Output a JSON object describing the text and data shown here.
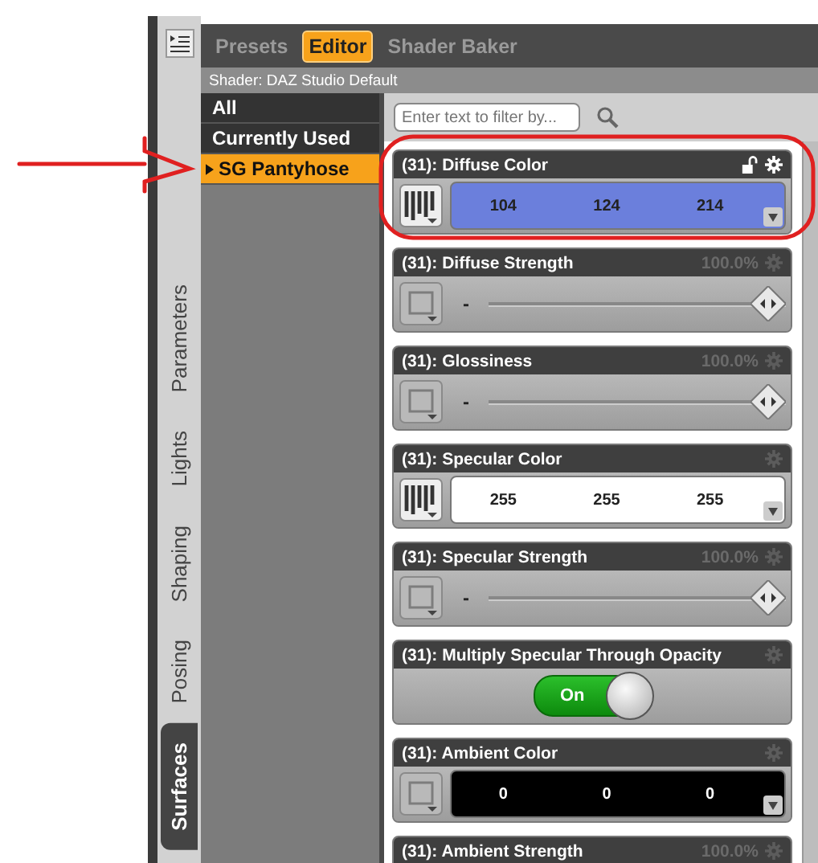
{
  "side_tabs": [
    {
      "label": "Parameters",
      "selected": false
    },
    {
      "label": "Lights",
      "selected": false
    },
    {
      "label": "Shaping",
      "selected": false
    },
    {
      "label": "Posing",
      "selected": false
    },
    {
      "label": "Surfaces",
      "selected": true
    }
  ],
  "tabs": [
    {
      "label": "Presets",
      "selected": false
    },
    {
      "label": "Editor",
      "selected": true
    },
    {
      "label": "Shader Baker",
      "selected": false
    }
  ],
  "shader_label": "Shader: DAZ Studio Default",
  "groups": [
    {
      "label": "All",
      "selected": false
    },
    {
      "label": "Currently Used",
      "selected": false
    },
    {
      "label": "SG Pantyhose",
      "selected": true
    }
  ],
  "filter": {
    "placeholder": "Enter text to filter by..."
  },
  "properties": [
    {
      "kind": "color",
      "title": "(31): Diffuse Color",
      "lock_visible": true,
      "color": "#6b7fdc",
      "values": [
        "104",
        "124",
        "214"
      ],
      "has_map": true
    },
    {
      "kind": "slider",
      "title": "(31): Diffuse Strength",
      "reading": "100.0%",
      "value": "-",
      "level": 1
    },
    {
      "kind": "slider",
      "title": "(31): Glossiness",
      "reading": "100.0%",
      "value": "-",
      "level": 1
    },
    {
      "kind": "color",
      "title": "(31): Specular Color",
      "lock_visible": false,
      "color": "#ffffff",
      "values": [
        "255",
        "255",
        "255"
      ],
      "has_map": true
    },
    {
      "kind": "slider",
      "title": "(31): Specular Strength",
      "reading": "100.0%",
      "value": "-",
      "level": 1
    },
    {
      "kind": "toggle",
      "title": "(31): Multiply Specular Through Opacity",
      "on": true,
      "label": "On"
    },
    {
      "kind": "color",
      "title": "(31): Ambient Color",
      "lock_visible": false,
      "color": "#000000",
      "values": [
        "0",
        "0",
        "0"
      ],
      "has_map": false
    },
    {
      "kind": "slider",
      "title": "(31): Ambient Strength",
      "reading": "100.0%"
    }
  ]
}
